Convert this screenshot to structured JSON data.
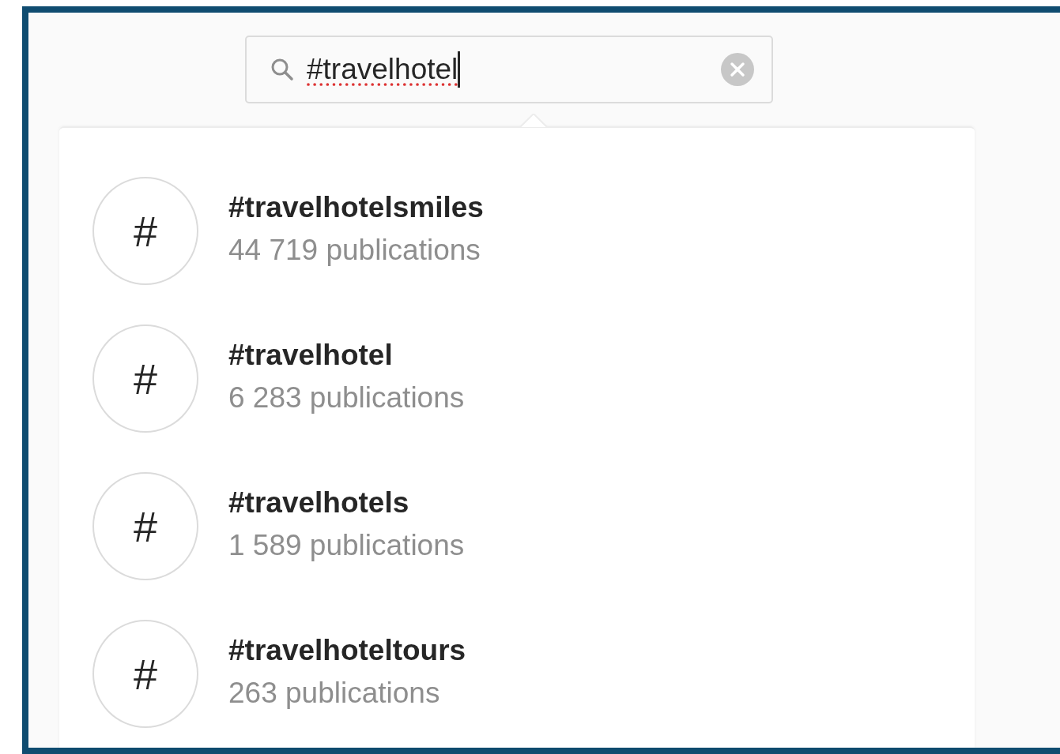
{
  "search": {
    "value": "#travelhotel"
  },
  "results": [
    {
      "tag": "#travelhotelsmiles",
      "count": "44 719 publications",
      "icon": "#"
    },
    {
      "tag": "#travelhotel",
      "count": "6 283 publications",
      "icon": "#"
    },
    {
      "tag": "#travelhotels",
      "count": "1 589 publications",
      "icon": "#"
    },
    {
      "tag": "#travelhoteltours",
      "count": "263 publications",
      "icon": "#"
    }
  ]
}
